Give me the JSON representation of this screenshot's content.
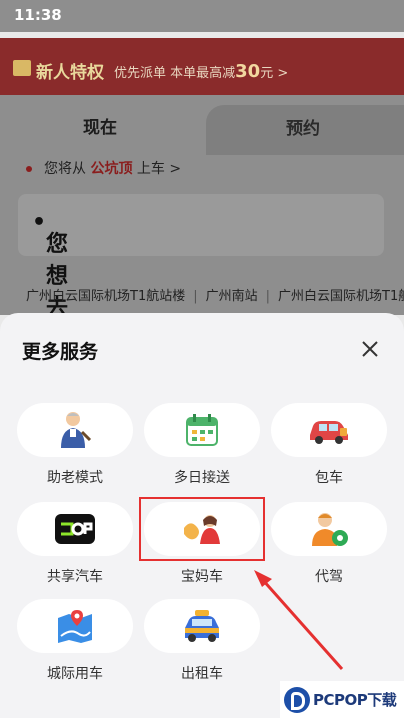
{
  "status_bar": {
    "time": "11:38"
  },
  "promo": {
    "title": "新人特权",
    "subtitle": "优先派单 本单最高减",
    "amount": "30",
    "suffix": "元 >"
  },
  "tabs": [
    {
      "label": "现在"
    },
    {
      "label": "预约"
    }
  ],
  "pickup": {
    "prefix": "您将从",
    "place": "公坑顶",
    "suffix": "上车 >"
  },
  "destination": {
    "placeholder": "您想去哪里?"
  },
  "recent_places": [
    "广州白云国际机场T1航站楼",
    "广州南站",
    "广州白云国际机场T1航"
  ],
  "sheet": {
    "title": "更多服务",
    "services": [
      {
        "label": "助老模式",
        "icon": "elderly-icon"
      },
      {
        "label": "多日接送",
        "icon": "calendar-icon"
      },
      {
        "label": "包车",
        "icon": "car-icon"
      },
      {
        "label": "共享汽车",
        "icon": "shared-car-icon"
      },
      {
        "label": "宝妈车",
        "icon": "mom-icon"
      },
      {
        "label": "代驾",
        "icon": "driver-icon"
      },
      {
        "label": "城际用车",
        "icon": "intercity-icon"
      },
      {
        "label": "出租车",
        "icon": "taxi-icon"
      }
    ]
  },
  "watermark": {
    "text": "PCPOP下载"
  },
  "colors": {
    "highlight": "#e53030",
    "arrow": "#e53030",
    "brand_red": "#8a2b2b"
  }
}
